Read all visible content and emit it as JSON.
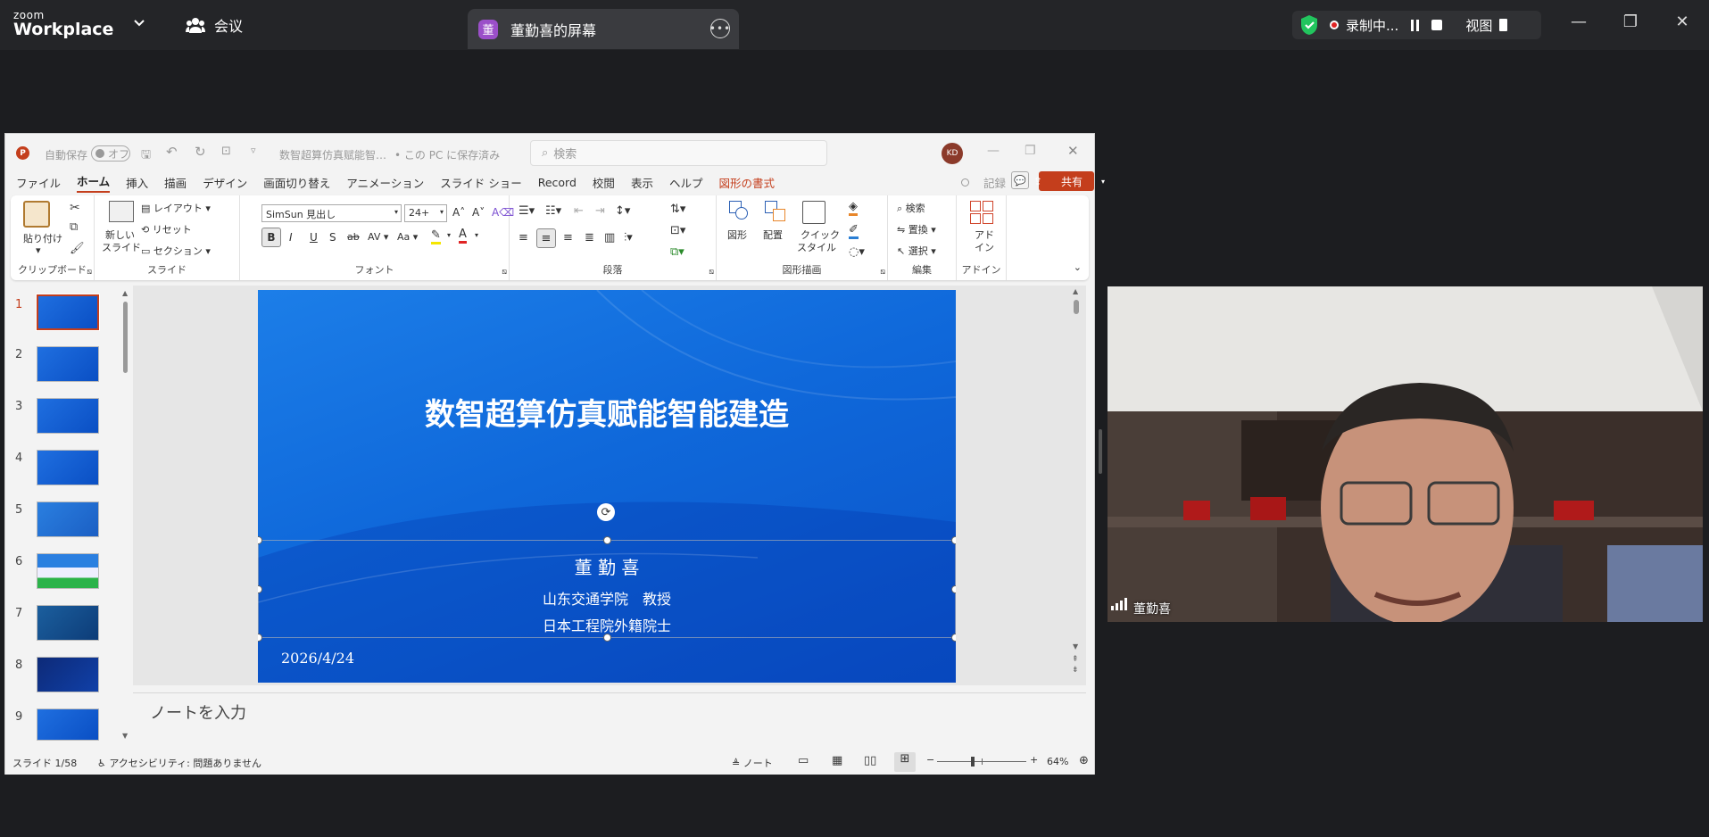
{
  "zoom": {
    "logo_small": "zoom",
    "logo_big": "Workplace",
    "meeting_label": "会议",
    "share_tab_avatar": "董",
    "share_tab_title": "董勤喜的屏幕",
    "recording_label": "录制中...",
    "view_label": "视图",
    "participant_name": "董勤喜",
    "colors": {
      "bar": "#242528",
      "tab": "#3a3b3f",
      "shield": "#22c55e",
      "record": "#e02424"
    }
  },
  "ppt": {
    "autosave_label": "自動保存",
    "autosave_state": "オフ",
    "file_name": "数智超算仿真赋能智…",
    "save_location": "• この PC に保存済み",
    "search_placeholder": "検索",
    "user_initials": "KD",
    "record_button": "記録",
    "share_button": "共有",
    "menu": [
      "ファイル",
      "ホーム",
      "挿入",
      "描画",
      "デザイン",
      "画面切り替え",
      "アニメーション",
      "スライド ショー",
      "Record",
      "校閲",
      "表示",
      "ヘルプ",
      "図形の書式"
    ],
    "active_menu": "ホーム",
    "ribbon": {
      "clipboard": {
        "paste": "貼り付け",
        "label": "クリップボード"
      },
      "slides": {
        "new_slide_1": "新しい",
        "new_slide_2": "スライド",
        "layout": "レイアウト",
        "reset": "リセット",
        "section": "セクション",
        "label": "スライド"
      },
      "font": {
        "font_name": "SimSun 見出し",
        "font_size": "24+",
        "label": "フォント",
        "bold": "B",
        "italic": "I",
        "underline": "U",
        "strike": "S",
        "strike2": "ab",
        "spacing": "AV",
        "case": "Aa"
      },
      "paragraph": {
        "label": "段落"
      },
      "drawing": {
        "shape": "図形",
        "arrange": "配置",
        "quick_style_1": "クイック",
        "quick_style_2": "スタイル",
        "label": "図形描画"
      },
      "editing": {
        "find": "検索",
        "replace": "置換",
        "select": "選択",
        "label": "編集"
      },
      "addin": {
        "addin_1": "アド",
        "addin_2": "イン",
        "label": "アドイン"
      }
    },
    "slide": {
      "title": "数智超算仿真赋能智能建造",
      "author": "董 勤 喜",
      "affiliation_1": "山东交通学院　教授",
      "affiliation_2": "日本工程院外籍院士",
      "date": "2026/4/24"
    },
    "thumbnail_numbers": [
      "1",
      "2",
      "3",
      "4",
      "5",
      "6",
      "7",
      "8",
      "9"
    ],
    "current_slide": 1,
    "notes_placeholder": "ノートを入力",
    "status": {
      "slide_count": "スライド 1/58",
      "accessibility": "アクセシビリティ: 問題ありません",
      "notes_button": "ノート",
      "zoom_level": "64%"
    }
  }
}
